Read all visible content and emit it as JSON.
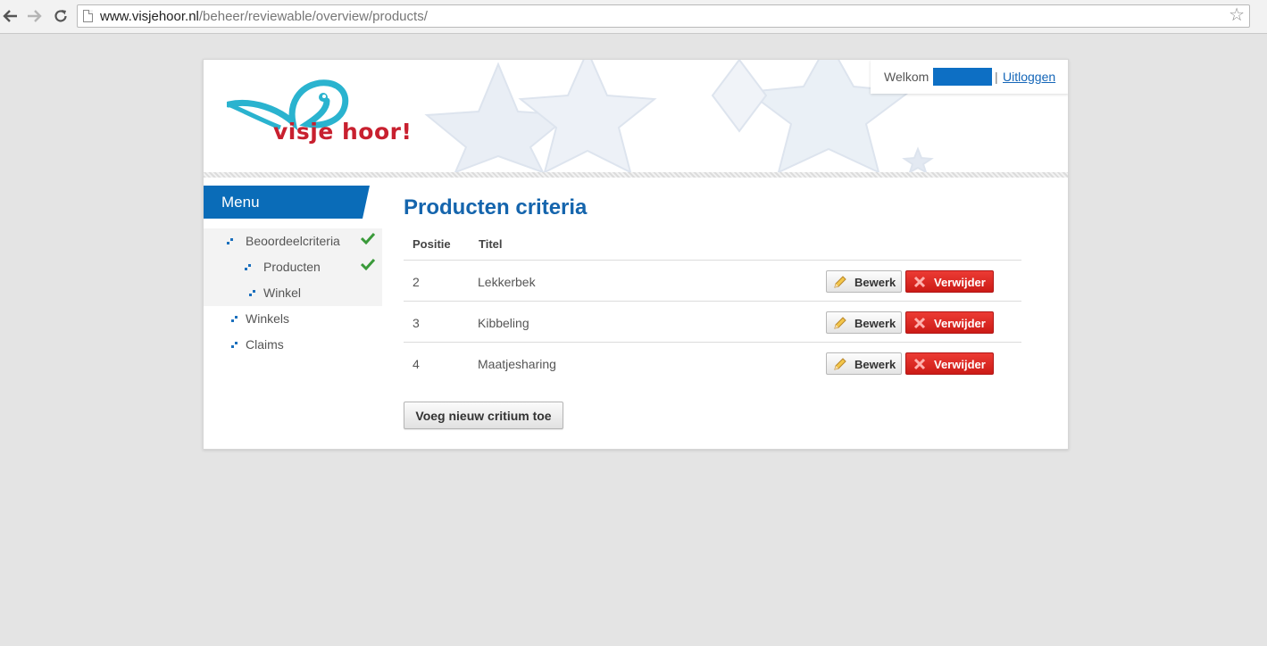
{
  "browser": {
    "back_icon": "back-arrow-icon",
    "forward_icon": "forward-arrow-icon",
    "reload_icon": "reload-icon",
    "url_host": "www.visjehoor.nl",
    "url_path": "/beheer/reviewable/overview/products/",
    "bookmark_icon": "star-icon"
  },
  "header": {
    "logo_text": "visje hoor!",
    "welcome_label": "Welkom",
    "separator": "|",
    "logout_label": "Uitloggen"
  },
  "menu": {
    "title": "Menu",
    "items": [
      {
        "label": "Beoordeelcriteria",
        "indent": false,
        "active": true,
        "checked": true
      },
      {
        "label": "Producten",
        "indent": true,
        "active": true,
        "checked": true
      },
      {
        "label": "Winkel",
        "indent": true,
        "active": true,
        "checked": false
      },
      {
        "label": "Winkels",
        "indent": false,
        "active": false,
        "checked": false
      },
      {
        "label": "Claims",
        "indent": false,
        "active": false,
        "checked": false
      }
    ]
  },
  "main": {
    "title": "Producten criteria",
    "columns": [
      "Positie",
      "Titel"
    ],
    "rows": [
      {
        "positie": "2",
        "titel": "Lekkerbek"
      },
      {
        "positie": "3",
        "titel": "Kibbeling"
      },
      {
        "positie": "4",
        "titel": "Maatjesharing"
      }
    ],
    "edit_label": "Bewerk",
    "delete_label": "Verwijder",
    "add_label": "Voeg nieuw critium toe"
  },
  "colors": {
    "brand_blue": "#1565ad",
    "logo_red": "#c8202f",
    "logo_fish": "#2ab3cf",
    "delete_red": "#d9231d"
  }
}
